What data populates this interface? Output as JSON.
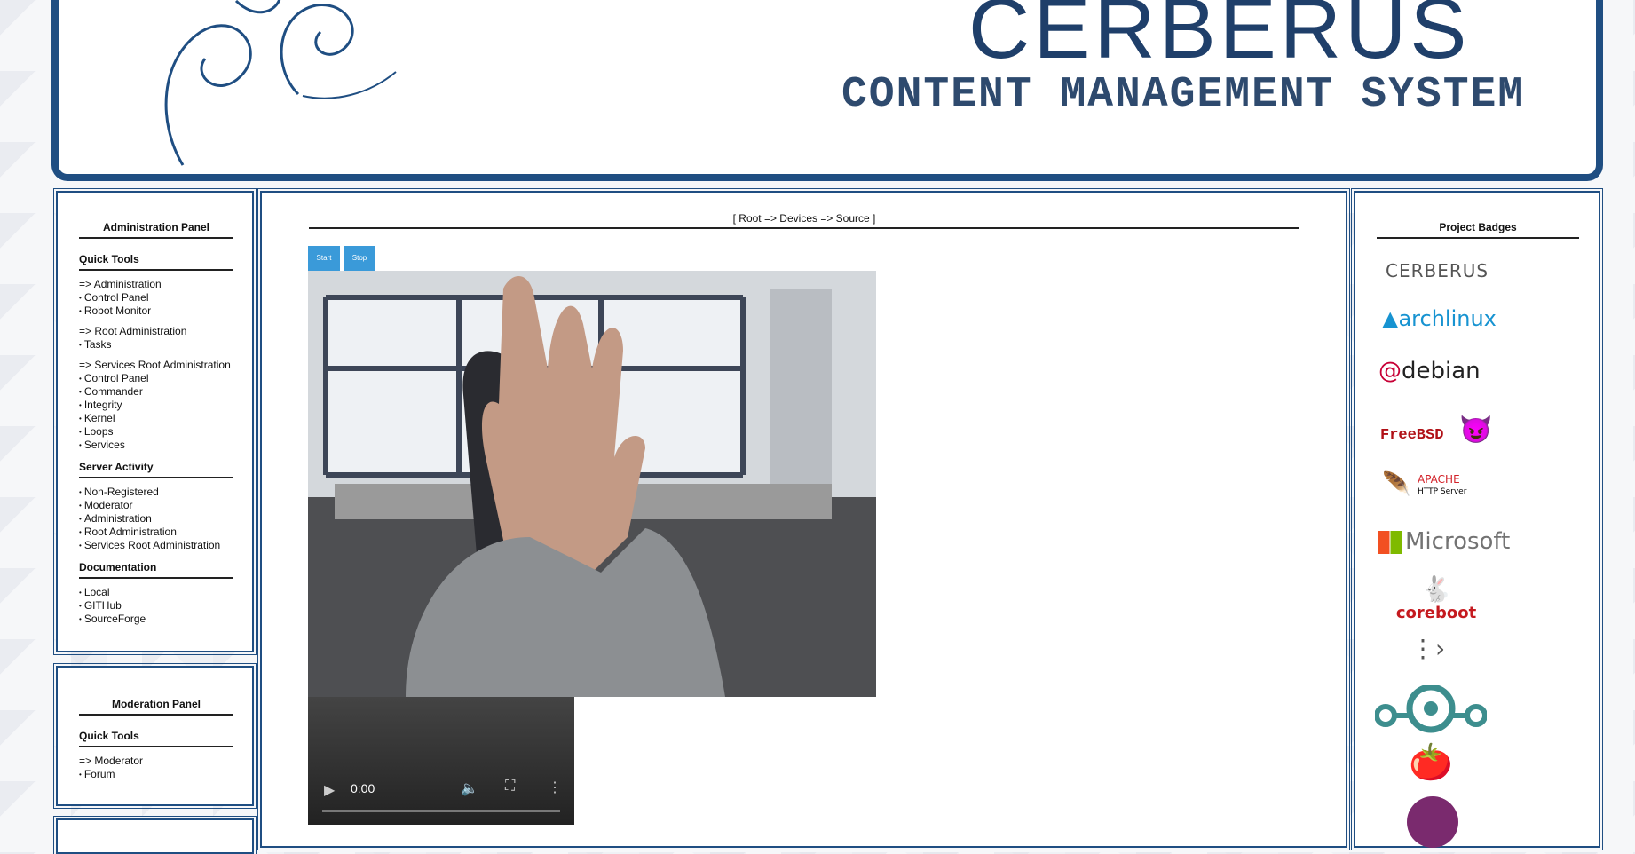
{
  "header": {
    "title": "CERBERUS",
    "subtitle": "CONTENT MANAGEMENT SYSTEM"
  },
  "admin_panel": {
    "title": "Administration Panel",
    "quick_tools_heading": "Quick Tools",
    "items_a": [
      "=> Administration",
      "Control Panel",
      "Robot Monitor"
    ],
    "items_b": [
      "=> Root Administration",
      "Tasks"
    ],
    "items_c": [
      "=> Services Root Administration",
      "Control Panel",
      "Commander",
      "Integrity",
      "Kernel",
      "Loops",
      "Services"
    ],
    "server_activity_heading": "Server Activity",
    "activity": [
      "Non-Registered",
      "Moderator",
      "Administration",
      "Root Administration",
      "Services Root Administration"
    ],
    "documentation_heading": "Documentation",
    "docs": [
      "Local",
      "GITHub",
      "SourceForge"
    ]
  },
  "moderation_panel": {
    "title": "Moderation Panel",
    "quick_tools_heading": "Quick Tools",
    "items": [
      "=> Moderator",
      "Forum"
    ]
  },
  "main": {
    "breadcrumb": "[ Root => Devices => Source ]",
    "start_label": "Start",
    "stop_label": "Stop",
    "video_time": "0:00"
  },
  "badges": {
    "title": "Project Badges",
    "cerberus": "CERBERUS",
    "arch": "archlinux",
    "debian": "debian",
    "freebsd": "FreeBSD",
    "apache_a": "APACHE",
    "apache_b": "HTTP Server",
    "microsoft": "Microsoft",
    "coreboot": "coreboot"
  }
}
